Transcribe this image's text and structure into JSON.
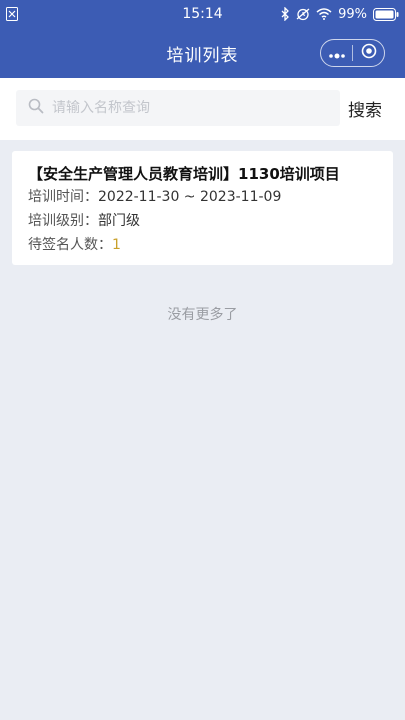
{
  "status_bar": {
    "time": "15:14",
    "battery": "99%",
    "icons": [
      "sim-icon",
      "bluetooth-icon",
      "alarm-icon",
      "wifi-icon",
      "battery-icon"
    ]
  },
  "nav": {
    "title": "培训列表",
    "more_icon": "more-dots-icon",
    "close_icon": "target-close-icon"
  },
  "search": {
    "placeholder": "请输入名称查询",
    "value": "",
    "button_label": "搜索"
  },
  "trainings": [
    {
      "title": "【安全生产管理人员教育培训】1130培训项目",
      "time_label": "培训时间：",
      "time_value": "2022-11-30 ~ 2023-11-09",
      "level_label": "培训级别：",
      "level_value": "部门级",
      "pending_label": "待签名人数：",
      "pending_value": "1"
    }
  ],
  "list_footer": "没有更多了",
  "colors": {
    "header_bg": "#3c5cb4",
    "page_bg": "#eaedf3",
    "count_accent": "#c9a02a"
  }
}
